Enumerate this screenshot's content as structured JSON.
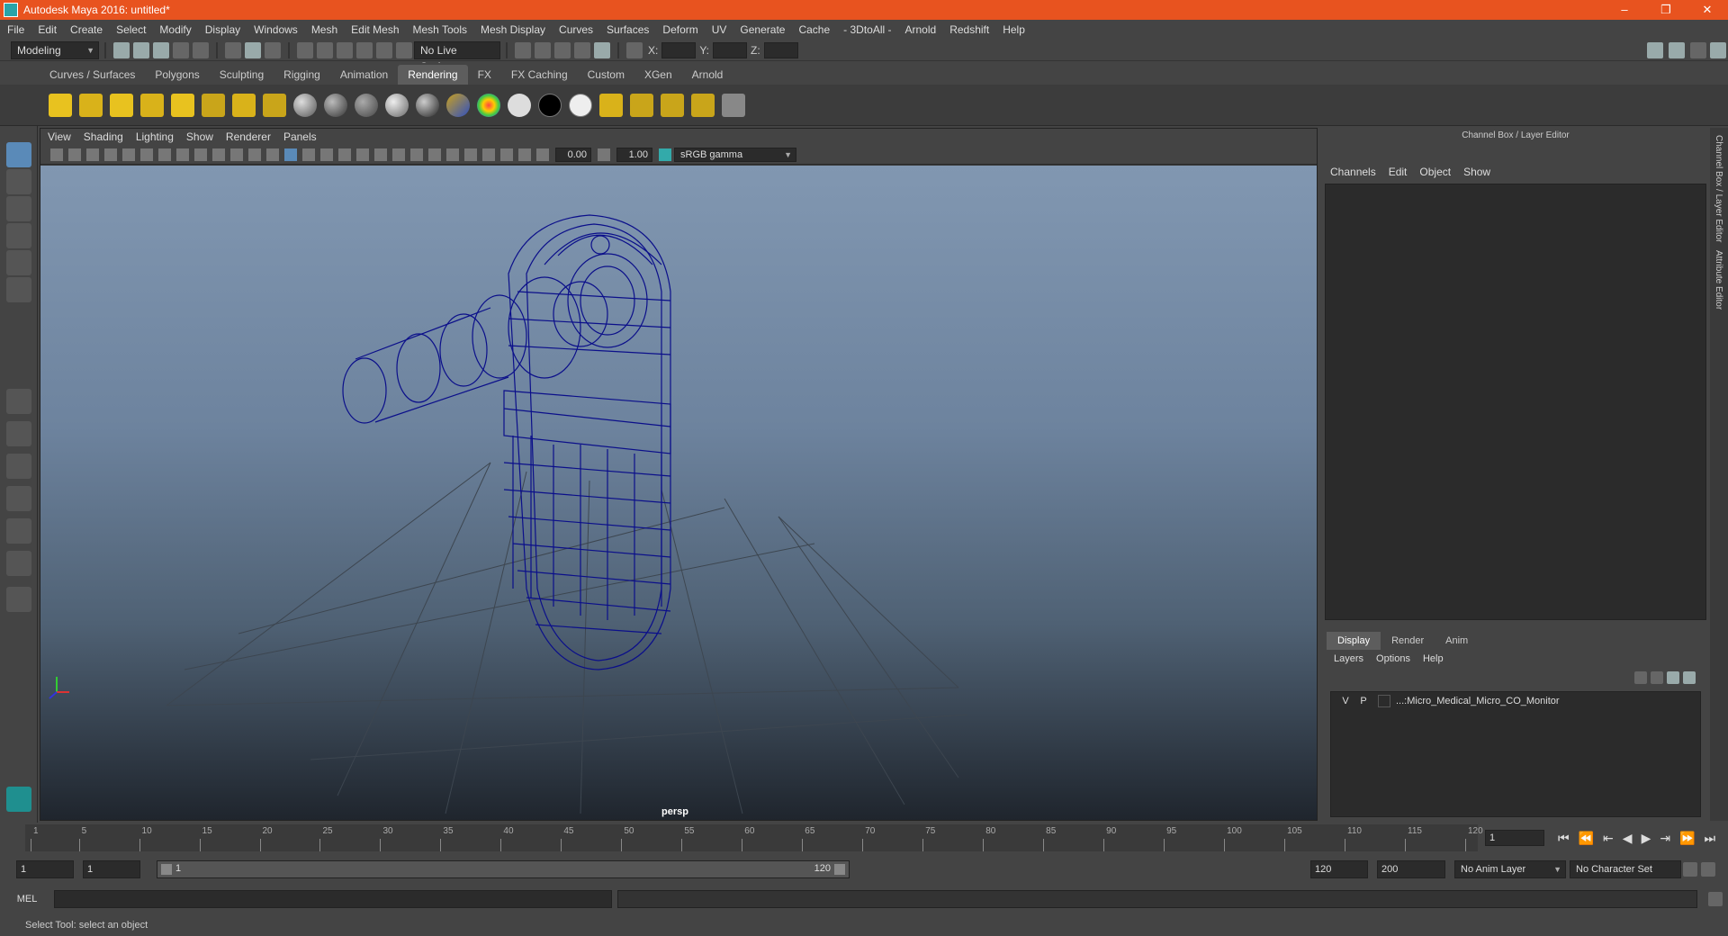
{
  "window": {
    "title": "Autodesk Maya 2016: untitled*",
    "controls": [
      "–",
      "❐",
      "✕"
    ]
  },
  "menubar": [
    "File",
    "Edit",
    "Create",
    "Select",
    "Modify",
    "Display",
    "Windows",
    "Mesh",
    "Edit Mesh",
    "Mesh Tools",
    "Mesh Display",
    "Curves",
    "Surfaces",
    "Deform",
    "UV",
    "Generate",
    "Cache",
    "- 3DtoAll -",
    "Arnold",
    "Redshift",
    "Help"
  ],
  "statusline": {
    "mode": "Modeling",
    "live_surface": "No Live Surface",
    "x_label": "X:",
    "y_label": "Y:",
    "z_label": "Z:"
  },
  "shelf_tabs": [
    "Curves / Surfaces",
    "Polygons",
    "Sculpting",
    "Rigging",
    "Animation",
    "Rendering",
    "FX",
    "FX Caching",
    "Custom",
    "XGen",
    "Arnold"
  ],
  "shelf_active": "Rendering",
  "panel_menu": [
    "View",
    "Shading",
    "Lighting",
    "Show",
    "Renderer",
    "Panels"
  ],
  "panel_toolbar": {
    "exposure": "0.00",
    "gamma": "1.00",
    "color_space": "sRGB gamma"
  },
  "viewport": {
    "camera_label": "persp"
  },
  "channel_box": {
    "title": "Channel Box / Layer Editor",
    "menu": [
      "Channels",
      "Edit",
      "Object",
      "Show"
    ]
  },
  "layer_editor": {
    "tabs": [
      "Display",
      "Render",
      "Anim"
    ],
    "active_tab": "Display",
    "menu": [
      "Layers",
      "Options",
      "Help"
    ],
    "layers": [
      {
        "v": "V",
        "p": "P",
        "name": "...:Micro_Medical_Micro_CO_Monitor"
      }
    ]
  },
  "side_tabs": [
    "Channel Box / Layer Editor",
    "Attribute Editor"
  ],
  "timeline": {
    "ticks": [
      "1",
      "5",
      "10",
      "15",
      "20",
      "25",
      "30",
      "35",
      "40",
      "45",
      "50",
      "55",
      "60",
      "65",
      "70",
      "75",
      "80",
      "85",
      "90",
      "95",
      "100",
      "105",
      "110",
      "115",
      "120"
    ],
    "current_frame": "1"
  },
  "range": {
    "start": "1",
    "playback_start": "1",
    "slider_start": "1",
    "slider_end": "120",
    "playback_end": "120",
    "end": "200",
    "anim_layer": "No Anim Layer",
    "character_set": "No Character Set"
  },
  "command_line": {
    "label": "MEL"
  },
  "help_line": "Select Tool: select an object",
  "colors": {
    "titlebar": "#e8531f",
    "wireframe": "#0b0f8a",
    "accent": "#5a8ab8"
  }
}
